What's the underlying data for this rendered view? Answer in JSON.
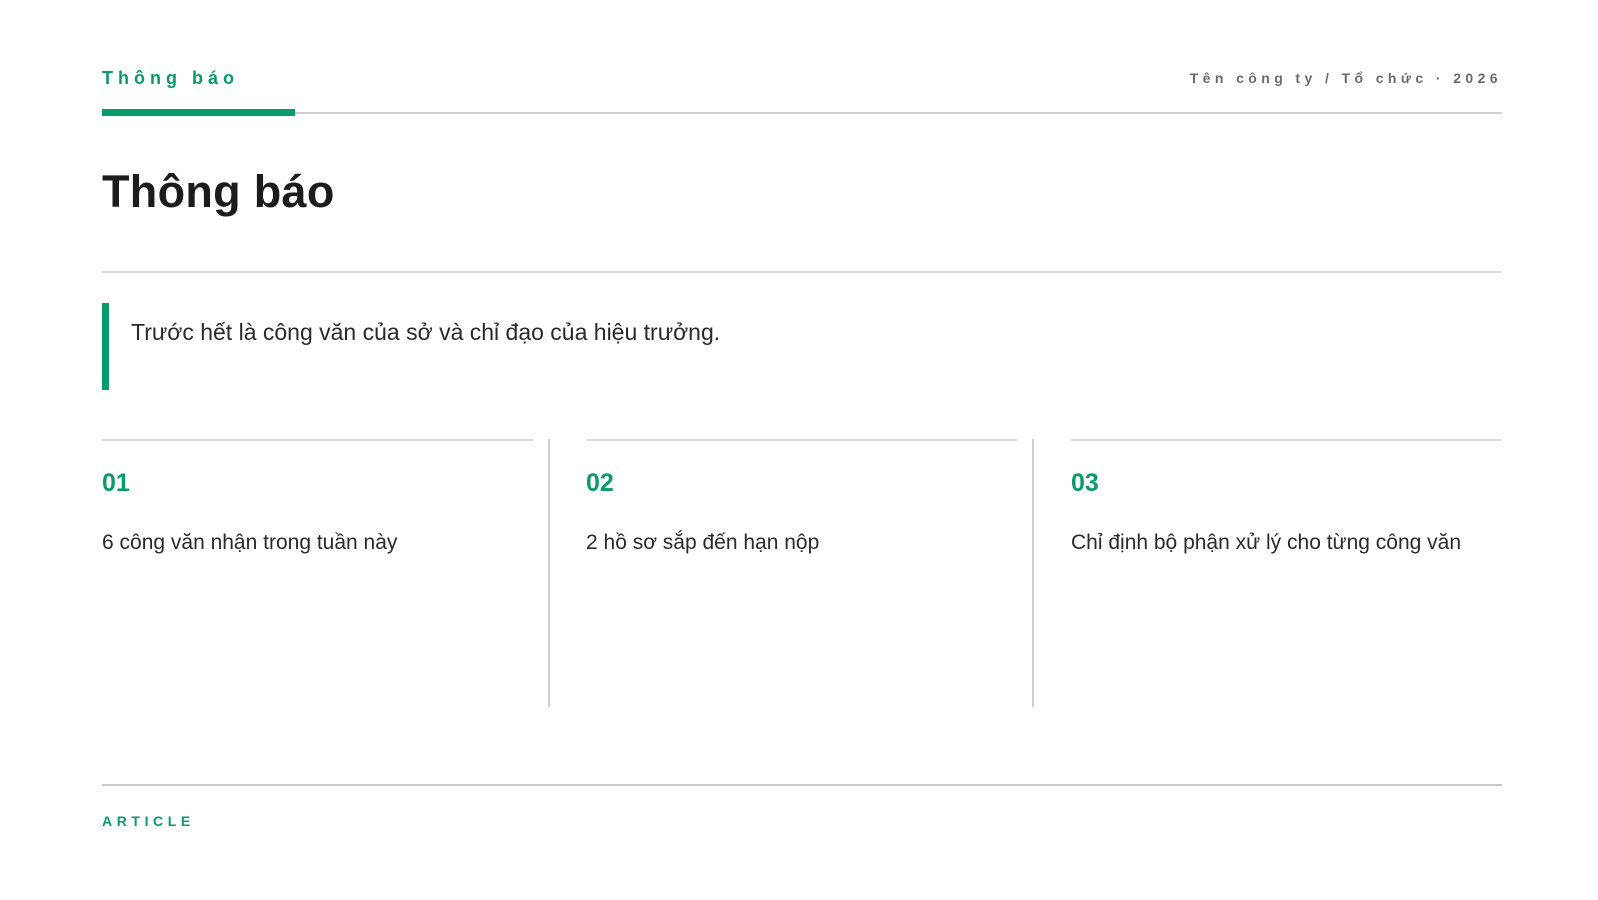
{
  "header": {
    "kicker": "Thông báo",
    "organization": "Tên công ty / Tổ chức · 2026"
  },
  "page_title": "Thông báo",
  "lead_quote": "Trước hết là công văn của sở và chỉ đạo của hiệu trưởng.",
  "columns": [
    {
      "number": "01",
      "text": "6 công văn nhận trong tuần này"
    },
    {
      "number": "02",
      "text": "2 hồ sơ sắp đến hạn nộp"
    },
    {
      "number": "03",
      "text": "Chỉ định bộ phận xử lý cho từng công văn"
    }
  ],
  "footer": {
    "label": "ARTICLE"
  },
  "colors": {
    "accent": "#0a9b6a",
    "text": "#222222",
    "muted": "#6b6b6b",
    "rule": "#dcdcdc"
  }
}
